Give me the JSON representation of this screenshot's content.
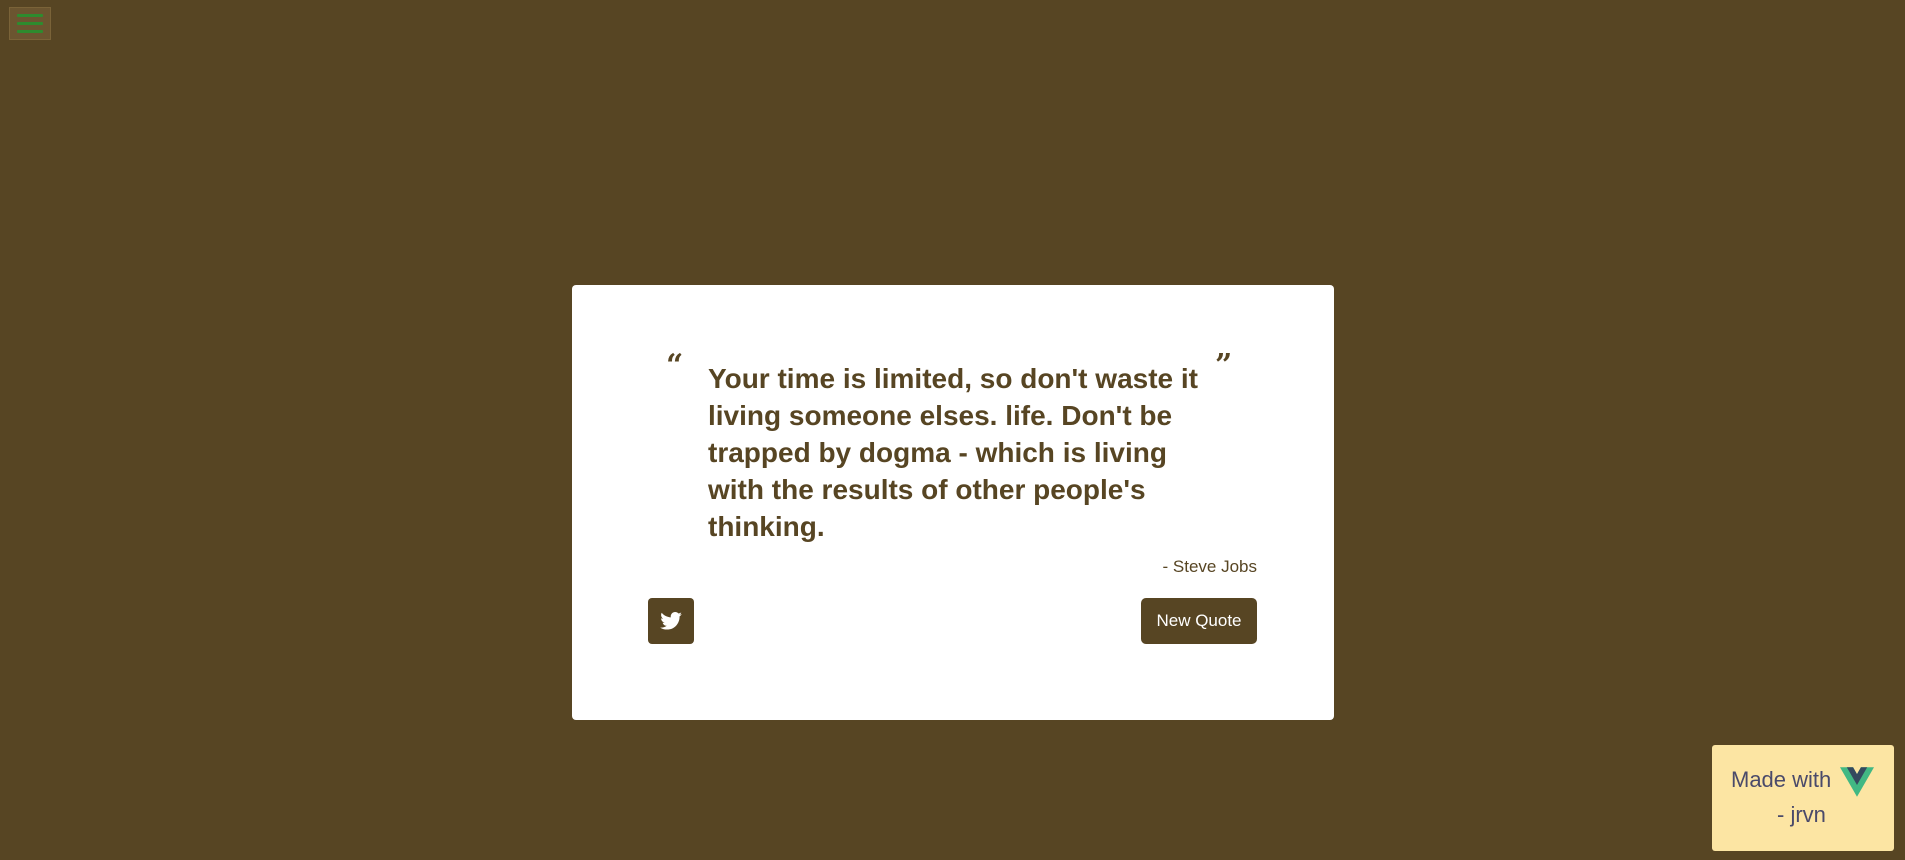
{
  "menu": {
    "icon": "hamburger-icon",
    "bar_color": "#2e8b2e"
  },
  "quote": {
    "open_mark": "“",
    "close_mark": "”",
    "text": "Your time is limited, so don't waste it living someone elses. life. Don't be trapped by dogma - which is living with the results of other people's thinking.",
    "author": "- Steve Jobs"
  },
  "actions": {
    "twitter_icon": "twitter-icon",
    "new_quote_label": "New Quote"
  },
  "footer_badge": {
    "made_with": "Made with",
    "logo": "vue-logo-icon",
    "author": "- jrvn"
  },
  "colors": {
    "background": "#574523",
    "card": "#ffffff",
    "badge": "#fce5a3"
  }
}
